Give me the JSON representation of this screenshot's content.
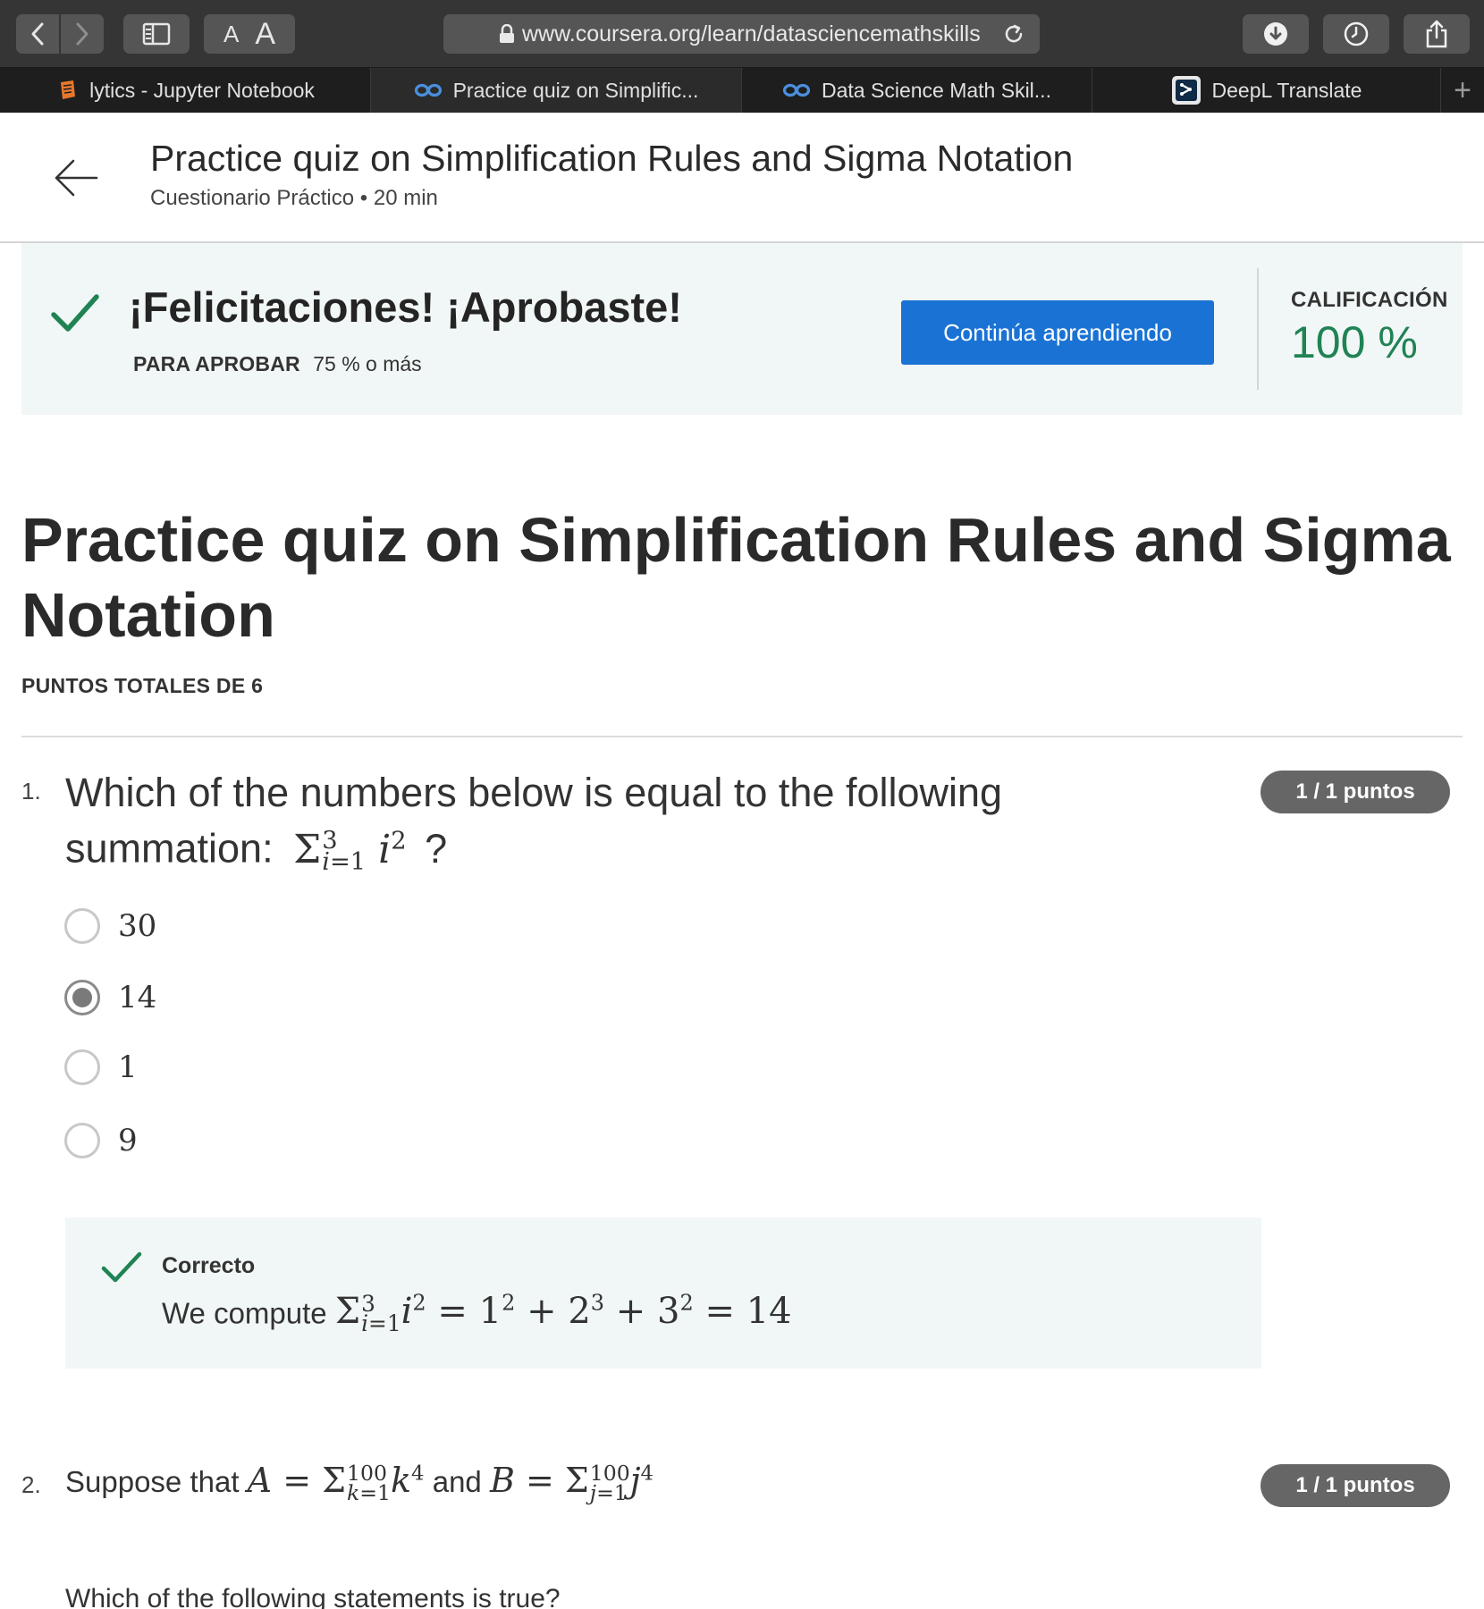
{
  "browser": {
    "url": "www.coursera.org/learn/datasciencemathskills",
    "font_small": "A",
    "font_large": "A",
    "tabs": [
      {
        "label": "lytics - Jupyter Notebook",
        "icon": "jupyter-icon"
      },
      {
        "label": "Practice quiz on Simplific...",
        "icon": "coursera-icon"
      },
      {
        "label": "Data Science Math Skil...",
        "icon": "coursera-icon"
      },
      {
        "label": "DeepL Translate",
        "icon": "deepl-icon"
      }
    ],
    "new_tab": "+"
  },
  "header": {
    "title": "Practice quiz on Simplification Rules and Sigma Notation",
    "subtitle": "Cuestionario Práctico • 20 min"
  },
  "banner": {
    "title": "¡Felicitaciones! ¡Aprobaste!",
    "pass_label": "PARA APROBAR",
    "pass_value": "75 % o más",
    "continue_button": "Continúa aprendiendo",
    "grade_label": "CALIFICACIÓN",
    "grade_value": "100 %",
    "colors": {
      "accent": "#1a73d4",
      "success": "#1f8354",
      "background": "#f1f7f6"
    }
  },
  "quiz": {
    "title": "Practice quiz on Simplification Rules and Sigma Notation",
    "total_points": "PUNTOS TOTALES DE 6",
    "questions": [
      {
        "number": "1.",
        "text": "Which of the numbers below is equal to the following summation:",
        "end_mark": "?",
        "points": "1 / 1 puntos",
        "options": [
          {
            "label": "30",
            "selected": false
          },
          {
            "label": "14",
            "selected": true
          },
          {
            "label": "1",
            "selected": false
          },
          {
            "label": "9",
            "selected": false
          }
        ],
        "feedback": {
          "label": "Correcto",
          "text": "We compute"
        }
      },
      {
        "number": "2.",
        "intro": "Suppose that",
        "and": "and",
        "points": "1 / 1 puntos",
        "prompt": "Which of the following statements is true?"
      }
    ]
  }
}
